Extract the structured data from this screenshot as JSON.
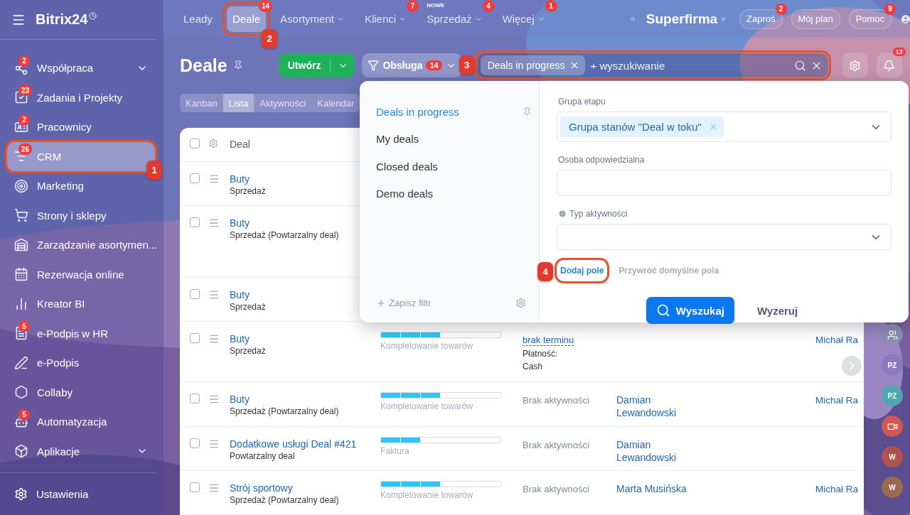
{
  "sidebar": {
    "logo": "Bitrix24",
    "items": [
      {
        "label": "Współpraca",
        "badge": "2",
        "expandable": true,
        "selected": false
      },
      {
        "label": "Zadania i Projekty",
        "badge": "23",
        "selected": false
      },
      {
        "label": "Pracownicy",
        "badge": "2",
        "selected": false
      },
      {
        "label": "CRM",
        "badge": "26",
        "selected": true,
        "callout": "1"
      },
      {
        "label": "Marketing",
        "selected": false
      },
      {
        "label": "Strony i sklepy",
        "selected": false
      },
      {
        "label": "Zarządzanie asortymen...",
        "selected": false
      },
      {
        "label": "Rezerwacja online",
        "selected": false
      },
      {
        "label": "Kreator BI",
        "selected": false
      },
      {
        "label": "e-Podpis w HR",
        "badge": "5",
        "selected": false
      },
      {
        "label": "e-Podpis",
        "selected": false
      },
      {
        "label": "Collaby",
        "selected": false
      },
      {
        "label": "Automatyzacja",
        "badge": "5",
        "selected": false
      },
      {
        "label": "Aplikacje",
        "expandable": true,
        "selected": false
      }
    ],
    "settings": "Ustawienia"
  },
  "top_nav": {
    "items": [
      {
        "label": "Leady",
        "selected": false
      },
      {
        "label": "Deale",
        "badge": "14",
        "selected": true,
        "callout": "2"
      },
      {
        "label": "Asortyment",
        "dropdown": true,
        "selected": false
      },
      {
        "label": "Klienci",
        "dropdown": true,
        "badge": "7",
        "selected": false
      },
      {
        "label": "Sprzedaż",
        "dropdown": true,
        "badge": "4",
        "tag": "NOWE",
        "selected": false
      },
      {
        "label": "Więcej",
        "dropdown": true,
        "badge": "1",
        "selected": false
      }
    ],
    "company": "Superfirma",
    "buttons": [
      {
        "label": "Zaproś",
        "badge": "2"
      },
      {
        "label": "Mój plan"
      },
      {
        "label": "Pomoc",
        "badge": "9"
      }
    ]
  },
  "header": {
    "title": "Deale",
    "create_button": "Utwórz",
    "pipeline": {
      "label": "Obsługa",
      "badge": "14"
    },
    "search": {
      "chip": "Deals in progress",
      "placeholder": "+ wyszukiwanie",
      "callout": "3"
    },
    "notifications_badge": "13"
  },
  "view_tabs": [
    {
      "label": "Kanban",
      "selected": false
    },
    {
      "label": "Lista",
      "selected": true
    },
    {
      "label": "Aktywności",
      "selected": false
    },
    {
      "label": "Kalendar",
      "selected": false
    }
  ],
  "filter_popup": {
    "presets": [
      {
        "label": "Deals in progress",
        "selected": true
      },
      {
        "label": "My deals",
        "selected": false
      },
      {
        "label": "Closed deals",
        "selected": false
      },
      {
        "label": "Demo deals",
        "selected": false
      }
    ],
    "save_filter": "Zapisz filtr",
    "fields": [
      {
        "kind": "multiselect",
        "label": "Grupa etapu",
        "chips": [
          "Grupa stanów \"Deal w toku\""
        ]
      },
      {
        "kind": "text",
        "label": "Osoba odpowiedzialna"
      },
      {
        "kind": "select",
        "label": "Typ aktywności",
        "required": true
      }
    ],
    "add_field": {
      "label": "Dodaj pole",
      "callout": "4"
    },
    "restore_fields": "Przywróć domyślne pola",
    "search_button": "Wyszukaj",
    "reset_button": "Wyzeruj"
  },
  "table": {
    "header": {
      "checked": false,
      "column_1": "Deal"
    },
    "rows": [
      {
        "checked": false,
        "title": "Buty",
        "subtitle": "Sprzedaż"
      },
      {
        "checked": false,
        "title": "Buty",
        "subtitle": "Sprzedaż (Powtarzalny deal)"
      },
      {
        "checked": false,
        "title": "Buty",
        "subtitle": "Sprzedaż"
      },
      {
        "checked": false,
        "title": "Buty",
        "subtitle": "Sprzedaż",
        "stage": {
          "label": "Kompletowanie towarów",
          "level": 0.5
        },
        "activity": {
          "kind": "deadline",
          "text": "brak terminu",
          "extra": [
            "Płatność:",
            "Cash"
          ]
        },
        "responsible": "Michał Ra"
      },
      {
        "checked": false,
        "title": "Buty",
        "subtitle": "Sprzedaż (Powtarzalny deal)",
        "stage": {
          "label": "Kompletowanie towarów",
          "level": 0.5
        },
        "activity": {
          "kind": "none",
          "text": "Brak aktywności"
        },
        "contact": "Damian Lewandowski",
        "responsible": "Michał Ra"
      },
      {
        "checked": false,
        "title": "Dodatkowe usługi Deal #421",
        "subtitle": "Powtarzalny deal",
        "stage": {
          "label": "Faktura",
          "level": 0.33
        },
        "activity": {
          "kind": "none",
          "text": "Brak aktywności"
        },
        "contact": "Damian Lewandowski"
      },
      {
        "checked": false,
        "title": "Strój sportowy",
        "subtitle": "Sprzedaż (Powtarzalny deal)",
        "stage": {
          "label": "Kompletowanie towarów",
          "level": 0.5
        },
        "activity": {
          "kind": "none",
          "text": "Brak aktywności"
        },
        "contact": "Marta Musińska",
        "responsible": "Michał Ra"
      }
    ]
  },
  "right_strip": [
    {
      "kind": "group",
      "color": "#8a8fb5"
    },
    {
      "kind": "initials",
      "text": "PZ",
      "color": "#8a7ac0"
    },
    {
      "kind": "initials",
      "text": "PZ",
      "color": "#4fa6b0"
    },
    {
      "kind": "video",
      "color": "#d0584f"
    },
    {
      "kind": "initials",
      "text": "W",
      "color": "#b0524a"
    },
    {
      "kind": "initials",
      "text": "W",
      "color": "#9c6a4e"
    }
  ]
}
